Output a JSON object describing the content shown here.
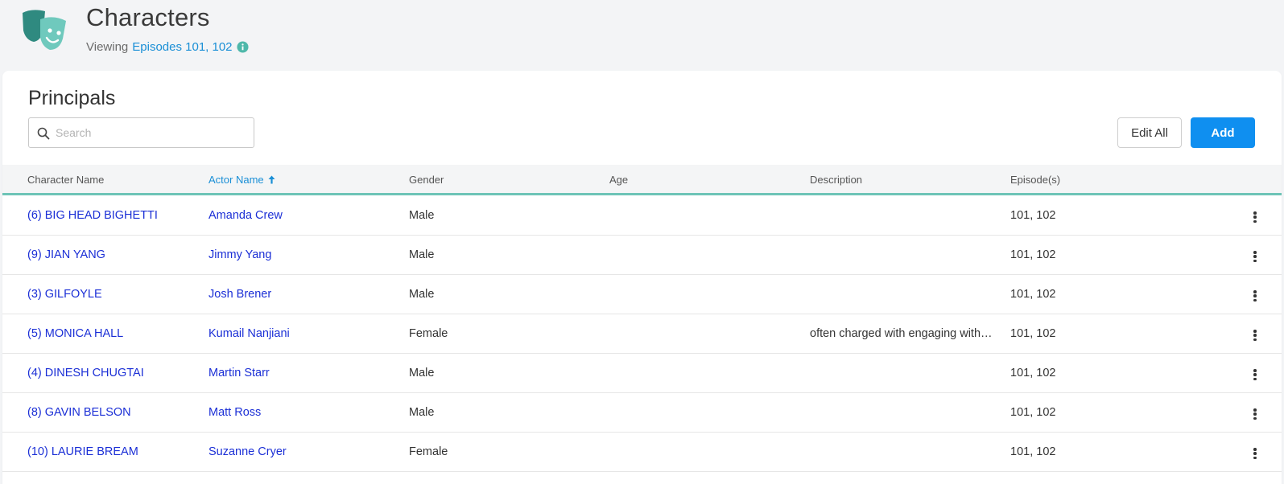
{
  "header": {
    "title": "Characters",
    "viewing_label": "Viewing",
    "episodes_link": "Episodes 101, 102"
  },
  "principals": {
    "title": "Principals",
    "search_placeholder": "Search",
    "edit_all_label": "Edit All",
    "add_label": "Add"
  },
  "table": {
    "columns": [
      "Character Name",
      "Actor Name",
      "Gender",
      "Age",
      "Description",
      "Episode(s)"
    ],
    "sorted_column": "Actor Name",
    "sort_direction": "ascending",
    "rows": [
      {
        "character": "(6) BIG HEAD BIGHETTI",
        "actor": "Amanda Crew",
        "gender": "Male",
        "age": "",
        "description": "",
        "episodes": "101, 102"
      },
      {
        "character": "(9) JIAN YANG",
        "actor": "Jimmy Yang",
        "gender": "Male",
        "age": "",
        "description": "",
        "episodes": "101, 102"
      },
      {
        "character": "(3) GILFOYLE",
        "actor": "Josh Brener",
        "gender": "Male",
        "age": "",
        "description": "",
        "episodes": "101, 102"
      },
      {
        "character": "(5) MONICA HALL",
        "actor": "Kumail Nanjiani",
        "gender": "Female",
        "age": "",
        "description": "often charged with engaging with…",
        "episodes": "101, 102"
      },
      {
        "character": "(4) DINESH CHUGTAI",
        "actor": "Martin Starr",
        "gender": "Male",
        "age": "",
        "description": "",
        "episodes": "101, 102"
      },
      {
        "character": "(8) GAVIN BELSON",
        "actor": "Matt Ross",
        "gender": "Male",
        "age": "",
        "description": "",
        "episodes": "101, 102"
      },
      {
        "character": "(10) LAURIE BREAM",
        "actor": "Suzanne Cryer",
        "gender": "Female",
        "age": "",
        "description": "",
        "episodes": "101, 102"
      }
    ]
  },
  "colors": {
    "accent_teal": "#6dc4b7",
    "link_blue": "#1a8fd6",
    "primary_button": "#0f8ff0",
    "row_link": "#1b2fd6"
  }
}
